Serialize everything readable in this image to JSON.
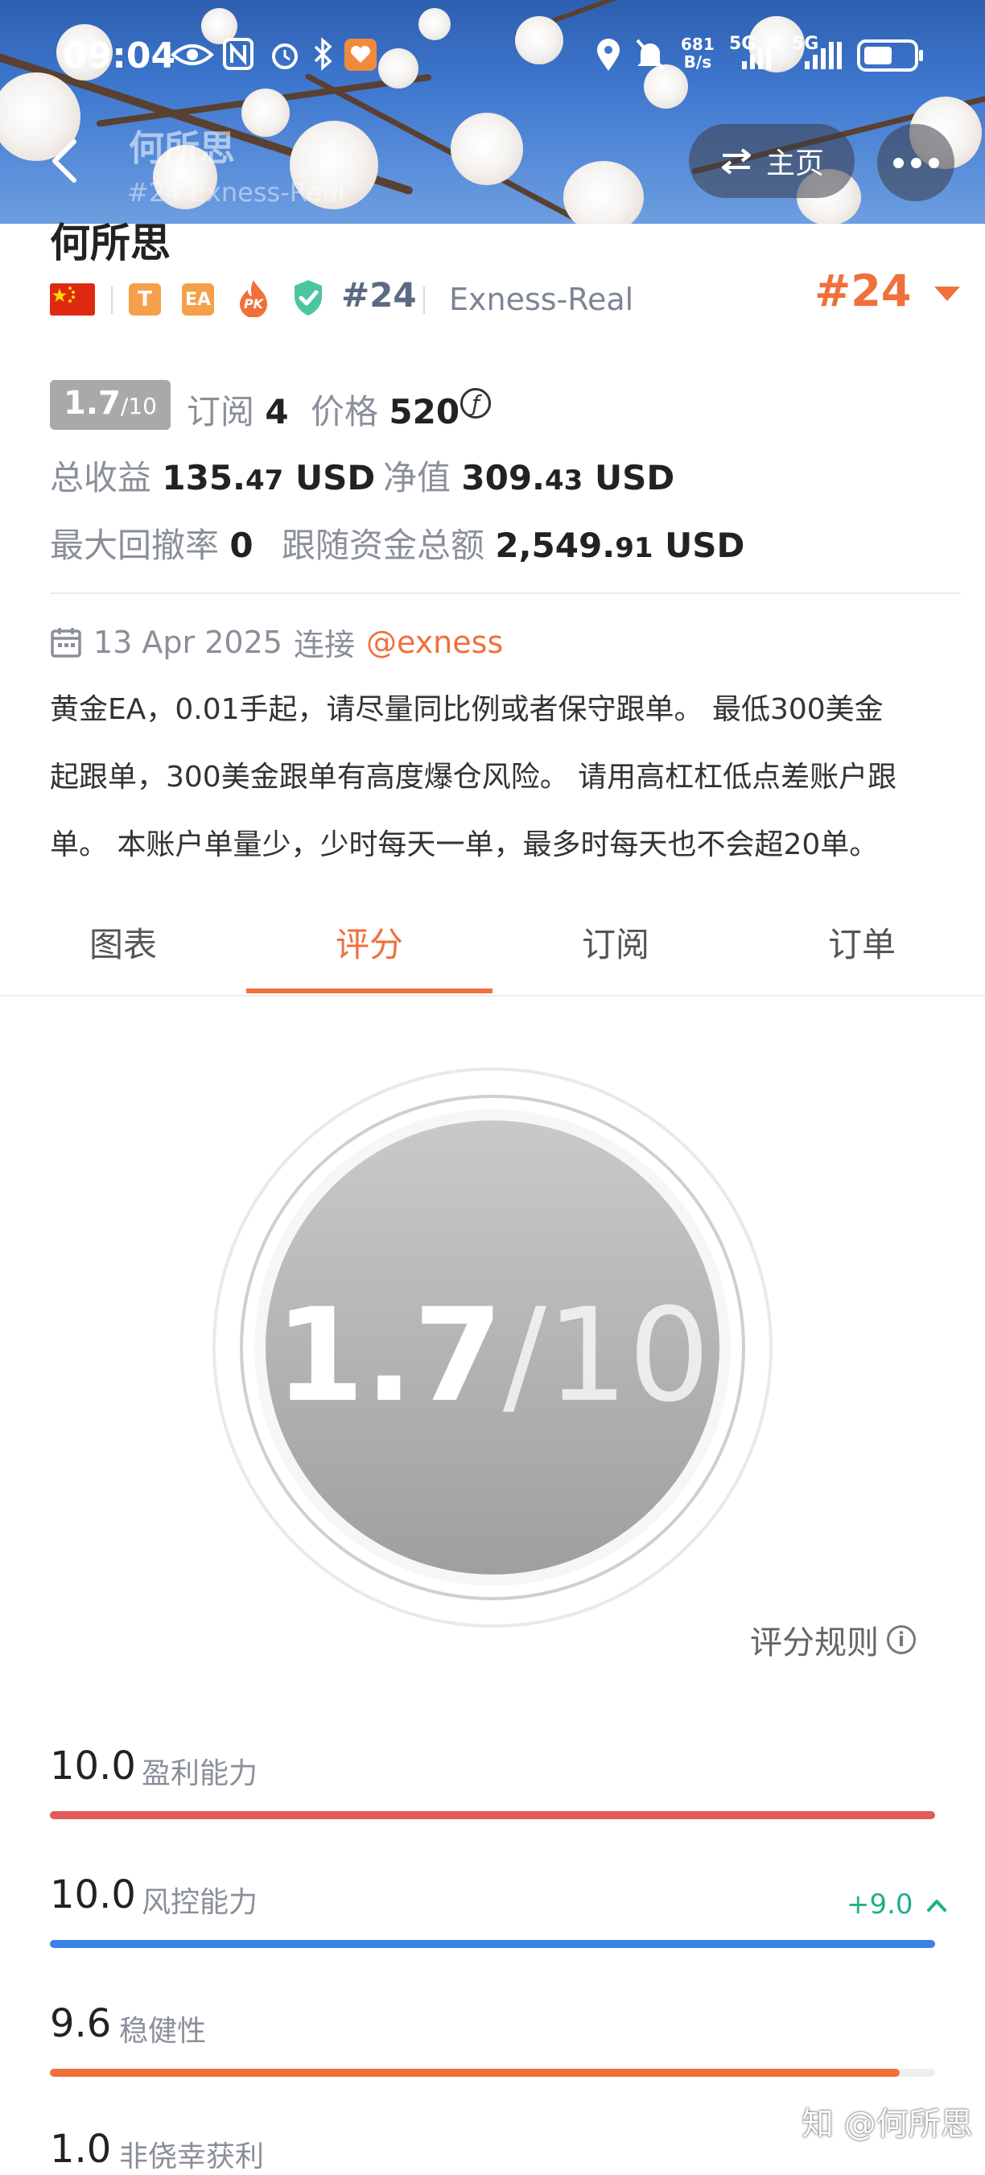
{
  "status_bar": {
    "time": "09:04",
    "net_speed_value": "681",
    "net_speed_unit": "B/s",
    "signal_1": "5G",
    "signal_2": "5G"
  },
  "header": {
    "title": "何所思",
    "subtitle": "#24   Exness-Real",
    "home_label": "主页"
  },
  "profile": {
    "name": "何所思",
    "badge_t": "T",
    "badge_ea": "EA",
    "badge_pk": "PK",
    "rank_inline": "#24",
    "server": "Exness-Real",
    "rank_right": "#24"
  },
  "stats": {
    "score_main": "1.7",
    "score_denom": "/10",
    "subs_label": "订阅",
    "subs_value": "4",
    "price_label": "价格",
    "price_value": "520",
    "price_currency_symbol": "ƒ",
    "total_profit_label": "总收益",
    "total_profit_int": "135.",
    "total_profit_dec": "47",
    "total_profit_unit": "USD",
    "equity_label": "净值",
    "equity_int": "309.",
    "equity_dec": "43",
    "equity_unit": "USD",
    "max_drawdown_label": "最大回撤率",
    "max_drawdown_value": "0",
    "follow_funds_label": "跟随资金总额",
    "follow_funds_int": "2,549.",
    "follow_funds_dec": "91",
    "follow_funds_unit": "USD"
  },
  "connection": {
    "date": "13 Apr 2025",
    "connect_label": "连接",
    "broker": "@exness"
  },
  "description": [
    "黄金EA，0.01手起，请尽量同比例或者保守跟单。 最低300美金",
    "起跟单，300美金跟单有高度爆仓风险。 请用高杠杠低点差账户跟",
    "单。 本账户单量少，少时每天一单，最多时每天也不会超20单。"
  ],
  "tabs": [
    "图表",
    "评分",
    "订阅",
    "订单"
  ],
  "active_tab_index": 1,
  "rating": {
    "score": "1.7",
    "denom": "/10",
    "rules_label": "评分规则",
    "info_glyph": "i"
  },
  "metrics": [
    {
      "value": "10.0",
      "label": "盈利能力",
      "fraction": 1.0,
      "color": "#e25a5a"
    },
    {
      "value": "10.0",
      "label": "风控能力",
      "fraction": 1.0,
      "color": "#3b82e6",
      "delta": "+9.0"
    },
    {
      "value": "9.6",
      "label": "稳健性",
      "fraction": 0.96,
      "color": "#f0703c"
    },
    {
      "value": "1.0",
      "label": "非侥幸获利",
      "fraction": 0.1,
      "color": "#aaaaaa"
    }
  ],
  "watermark": "知 @何所思",
  "colors": {
    "accent": "#f0703c",
    "rank_blue_grey": "#5b6a83",
    "positive_green": "#1db08a"
  }
}
